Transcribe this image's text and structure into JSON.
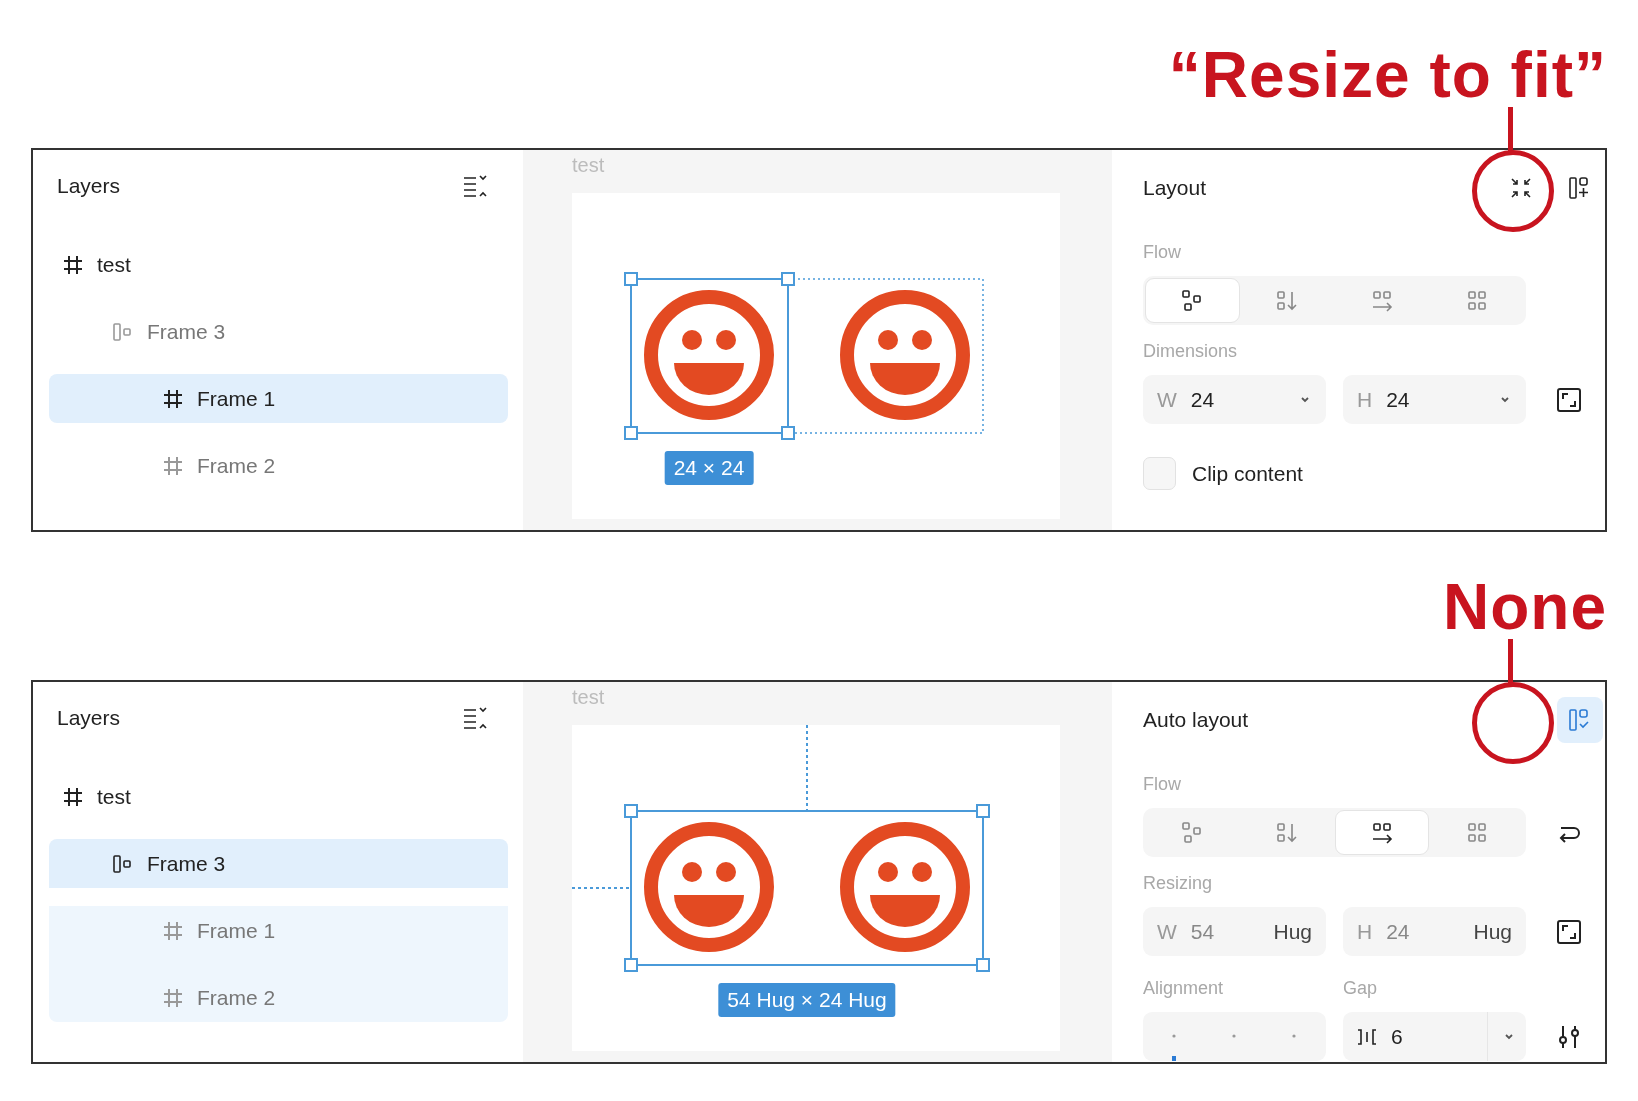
{
  "panels": [
    {
      "annotation": {
        "text": "“Resize to fit”"
      },
      "layers": {
        "title": "Layers",
        "items": [
          {
            "kind": "frame",
            "name": "test",
            "selected": false,
            "dimmed": false,
            "children": [
              {
                "kind": "auto_layout",
                "name": "Frame 3",
                "selected": false,
                "dimmed": true,
                "children": [
                  {
                    "kind": "frame",
                    "name": "Frame 1",
                    "selected": true,
                    "dimmed": false
                  },
                  {
                    "kind": "frame",
                    "name": "Frame 2",
                    "selected": false,
                    "dimmed": true
                  }
                ]
              }
            ]
          }
        ]
      },
      "canvas": {
        "frame_label": "test",
        "selection": {
          "kind": "single",
          "label": "24 × 24"
        }
      },
      "properties": {
        "title": "Layout",
        "header_buttons": [
          {
            "kind": "resize_to_fit",
            "selected": false
          },
          {
            "kind": "add_auto_layout",
            "selected": false
          }
        ],
        "sections": [
          {
            "kind": "flow",
            "label": "Flow",
            "options": [
              {
                "kind": "freeform",
                "selected": true
              },
              {
                "kind": "vertical",
                "selected": false
              },
              {
                "kind": "horizontal",
                "selected": false
              },
              {
                "kind": "grid",
                "selected": false
              }
            ]
          },
          {
            "kind": "size",
            "label": "Dimensions",
            "fields": [
              {
                "prefix": "W",
                "value": "24"
              },
              {
                "prefix": "H",
                "value": "24"
              }
            ]
          },
          {
            "kind": "checkbox",
            "label": "Clip content",
            "checked": false
          }
        ]
      }
    },
    {
      "annotation": {
        "text": "None"
      },
      "layers": {
        "title": "Layers",
        "items": [
          {
            "kind": "frame",
            "name": "test",
            "selected": false,
            "dimmed": false,
            "children": [
              {
                "kind": "auto_layout",
                "name": "Frame 3",
                "selected": true,
                "dimmed": false,
                "children": [
                  {
                    "kind": "frame",
                    "name": "Frame 1",
                    "selected": false,
                    "dimmed": true
                  },
                  {
                    "kind": "frame",
                    "name": "Frame 2",
                    "selected": false,
                    "dimmed": true
                  }
                ]
              }
            ]
          }
        ]
      },
      "canvas": {
        "frame_label": "test",
        "selection": {
          "kind": "group",
          "label": "54 Hug × 24 Hug"
        }
      },
      "properties": {
        "title": "Auto layout",
        "header_buttons": [
          {
            "kind": "auto_layout",
            "selected": true
          }
        ],
        "sections": [
          {
            "kind": "flow",
            "label": "Flow",
            "side_button": {
              "kind": "wrap"
            },
            "options": [
              {
                "kind": "freeform",
                "selected": false
              },
              {
                "kind": "vertical",
                "selected": false
              },
              {
                "kind": "horizontal",
                "selected": true
              },
              {
                "kind": "grid",
                "selected": false
              }
            ]
          },
          {
            "kind": "size",
            "label": "Resizing",
            "fields": [
              {
                "prefix": "W",
                "value": "54",
                "mode": "Hug"
              },
              {
                "prefix": "H",
                "value": "24",
                "mode": "Hug"
              }
            ]
          },
          {
            "kind": "alignment_gap",
            "alignment_label": "Alignment",
            "gap_label": "Gap",
            "gap_value": "6"
          }
        ]
      }
    }
  ]
}
